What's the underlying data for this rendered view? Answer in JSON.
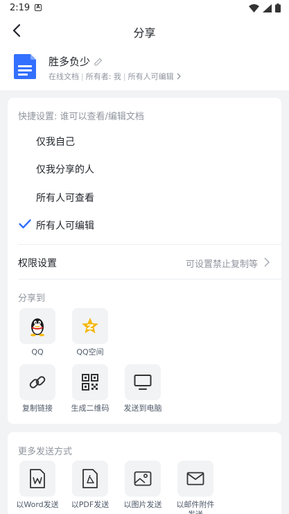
{
  "status_bar": {
    "time": "2:19",
    "notification_glyph": "A",
    "icons": [
      "wifi-icon",
      "signal-icon",
      "battery-icon"
    ]
  },
  "nav": {
    "title": "分享",
    "back_icon": "chevron-left-icon"
  },
  "document": {
    "name": "胜多负少",
    "meta": [
      "在线文档",
      "所有者: 我",
      "所有人可编辑"
    ],
    "accent": "#3370ff"
  },
  "quick_settings": {
    "label": "快捷设置: 谁可以查看/编辑文档",
    "options": [
      {
        "label": "仅我自己",
        "selected": false
      },
      {
        "label": "仅我分享的人",
        "selected": false
      },
      {
        "label": "所有人可查看",
        "selected": false
      },
      {
        "label": "所有人可编辑",
        "selected": true
      }
    ]
  },
  "permissions": {
    "label": "权限设置",
    "hint": "可设置禁止复制等"
  },
  "share_to": {
    "label": "分享到",
    "items": [
      {
        "label": "QQ",
        "icon": "qq-penguin-icon"
      },
      {
        "label": "QQ空间",
        "icon": "qzone-star-icon"
      },
      {
        "label": "复制链接",
        "icon": "link-icon"
      },
      {
        "label": "生成二维码",
        "icon": "qrcode-icon"
      },
      {
        "label": "发送到电脑",
        "icon": "monitor-icon"
      }
    ]
  },
  "more_send": {
    "label": "更多发送方式",
    "items": [
      {
        "label": "以Word发送",
        "icon": "word-file-icon"
      },
      {
        "label": "以PDF发送",
        "icon": "pdf-file-icon"
      },
      {
        "label": "以图片发送",
        "icon": "image-icon"
      },
      {
        "label": "以邮件附件",
        "label2": "发送",
        "icon": "mail-icon"
      }
    ]
  },
  "colors": {
    "check": "#3370ff",
    "qzone_yellow": "#f5b80f"
  }
}
